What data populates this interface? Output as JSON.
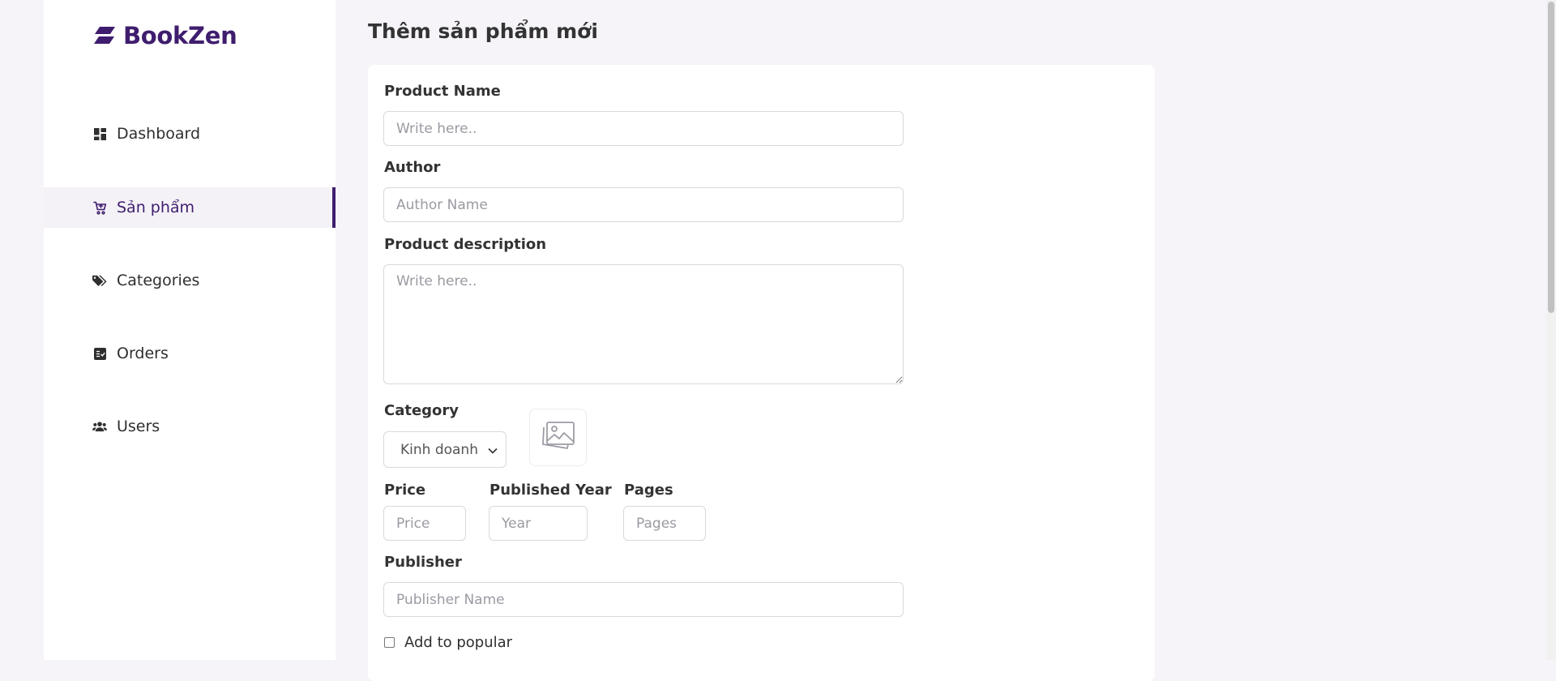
{
  "app": {
    "brand": "BookZen"
  },
  "sidebar": {
    "items": [
      {
        "label": "Dashboard",
        "icon": "dashboard-icon",
        "active": false
      },
      {
        "label": "Sản phẩm",
        "icon": "cart-icon",
        "active": true
      },
      {
        "label": "Categories",
        "icon": "tags-icon",
        "active": false
      },
      {
        "label": "Orders",
        "icon": "orders-icon",
        "active": false
      },
      {
        "label": "Users",
        "icon": "users-icon",
        "active": false
      }
    ]
  },
  "page": {
    "title": "Thêm sản phẩm mới"
  },
  "form": {
    "product_name": {
      "label": "Product Name",
      "placeholder": "Write here..",
      "value": ""
    },
    "author": {
      "label": "Author",
      "placeholder": "Author Name",
      "value": ""
    },
    "description": {
      "label": "Product description",
      "placeholder": "Write here..",
      "value": ""
    },
    "category": {
      "label": "Category",
      "selected": "Kinh doanh"
    },
    "price": {
      "label": "Price",
      "placeholder": "Price"
    },
    "published_year": {
      "label": "Published Year",
      "placeholder": "Year"
    },
    "pages": {
      "label": "Pages",
      "placeholder": "Pages"
    },
    "publisher": {
      "label": "Publisher",
      "placeholder": "Publisher Name"
    },
    "popular": {
      "label": "Add to popular",
      "checked": false
    }
  },
  "colors": {
    "accent": "#3f1d6e",
    "background": "#f6f4f9",
    "card": "#ffffff"
  }
}
